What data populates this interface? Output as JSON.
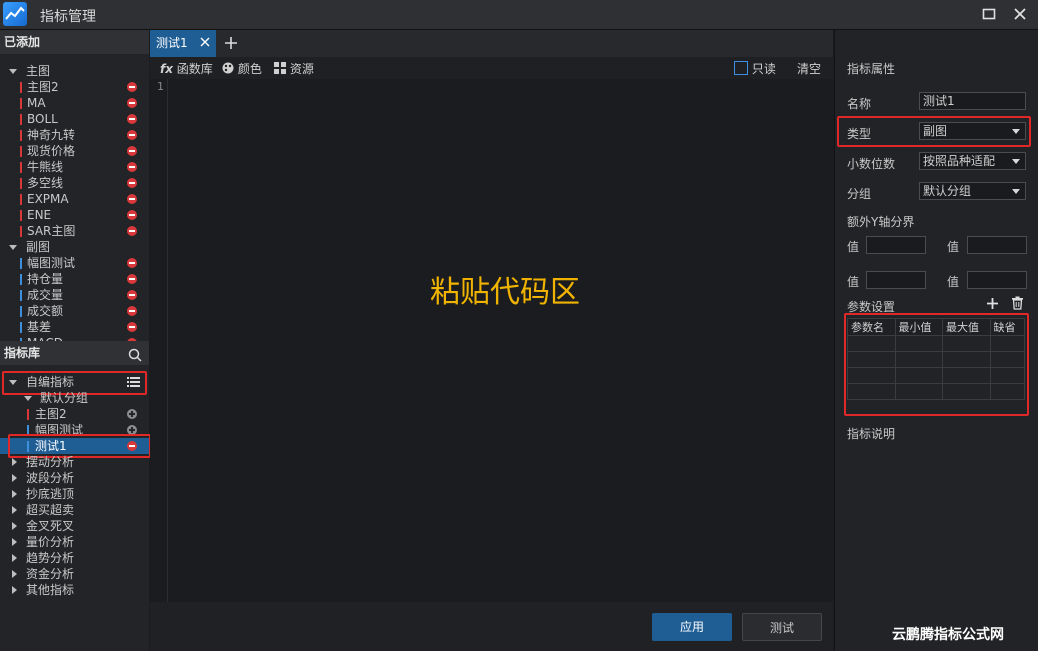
{
  "window": {
    "title": "指标管理",
    "maximize_icon": "maximize-icon",
    "close_icon": "close-icon"
  },
  "added": {
    "header": "已添加",
    "main_group": "主图",
    "main_items": [
      "主图2",
      "MA",
      "BOLL",
      "神奇九转",
      "现货价格",
      "牛熊线",
      "多空线",
      "EXPMA",
      "ENE",
      "SAR主图"
    ],
    "sub_group": "副图",
    "sub_items": [
      "幅图测试",
      "持仓量",
      "成交量",
      "成交额",
      "基差",
      "MACD"
    ]
  },
  "library": {
    "header": "指标库",
    "custom_group": "自编指标",
    "default_subgroup": "默认分组",
    "custom_items": [
      "主图2",
      "幅图测试",
      "测试1"
    ],
    "categories": [
      "摆动分析",
      "波段分析",
      "抄底逃顶",
      "超买超卖",
      "金叉死叉",
      "量价分析",
      "趋势分析",
      "资金分析",
      "其他指标"
    ]
  },
  "editor": {
    "tab_label": "测试1",
    "toolbar": {
      "functions": "函数库",
      "color": "颜色",
      "resources": "资源",
      "readonly": "只读",
      "clear": "清空"
    },
    "line_number": "1",
    "placeholder": "粘贴代码区",
    "apply_button": "应用",
    "test_button": "测试"
  },
  "properties": {
    "header": "指标属性",
    "name_label": "名称",
    "name_value": "测试1",
    "type_label": "类型",
    "type_value": "副图",
    "decimals_label": "小数位数",
    "decimals_value": "按照品种适配",
    "group_label": "分组",
    "group_value": "默认分组",
    "y_axis_label": "额外Y轴分界",
    "value_label": "值",
    "params_label": "参数设置",
    "param_columns": [
      "参数名",
      "最小值",
      "最大值",
      "缺省"
    ],
    "description_label": "指标说明"
  },
  "colors": {
    "accent": "#1f5d95",
    "remove": "#d9383a",
    "highlight": "#e02828",
    "placeholder": "#f0b400"
  },
  "watermark": "云鹏腾指标公式网"
}
